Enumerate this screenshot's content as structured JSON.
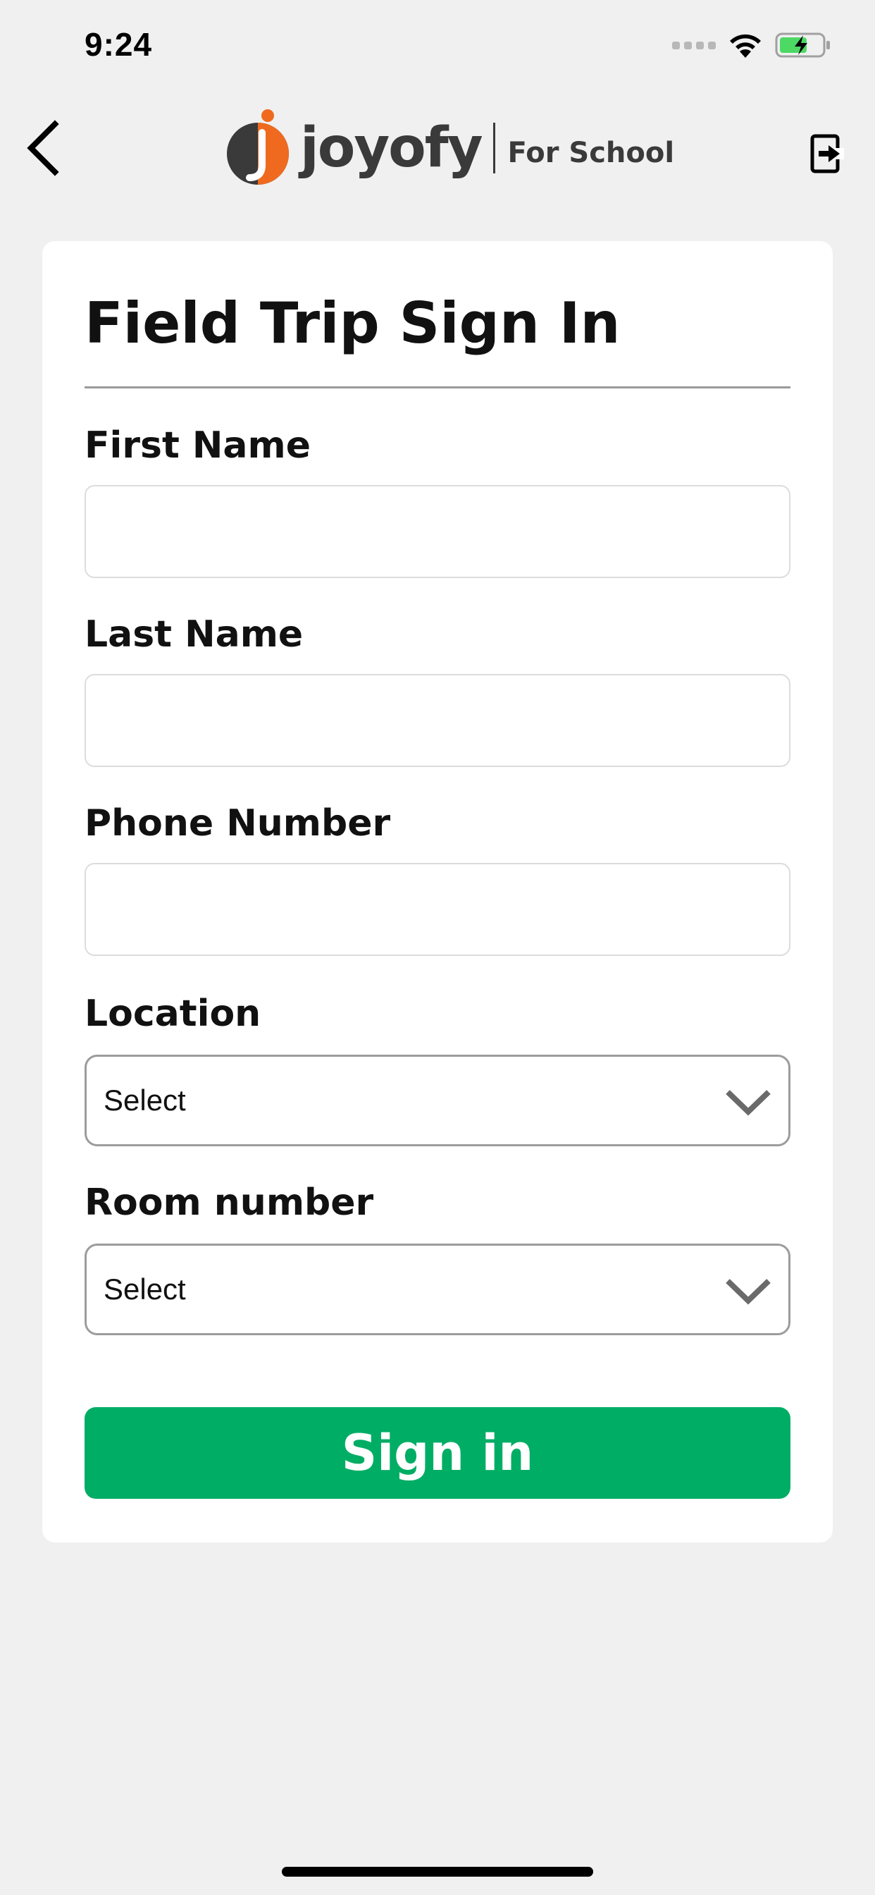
{
  "status_bar": {
    "time": "9:24",
    "icons": [
      "signal-icon",
      "wifi-icon",
      "battery-charging-icon"
    ]
  },
  "header": {
    "back_icon": "chevron-left-icon",
    "logo": {
      "word": "joyofy",
      "sub": "For School",
      "colors": {
        "dark": "#3a3a3a",
        "accent": "#ef6a1f"
      }
    },
    "logout_icon": "logout-icon"
  },
  "form": {
    "title": "Field Trip Sign In",
    "fields": {
      "first_name": {
        "label": "First Name",
        "value": "",
        "placeholder": ""
      },
      "last_name": {
        "label": "Last Name",
        "value": "",
        "placeholder": ""
      },
      "phone_number": {
        "label": "Phone Number",
        "value": "",
        "placeholder": ""
      },
      "location": {
        "label": "Location",
        "selected": "Select"
      },
      "room_number": {
        "label": "Room number",
        "selected": "Select"
      }
    },
    "submit_label": "Sign in"
  },
  "colors": {
    "background": "#f0f0f0",
    "card": "#ffffff",
    "primary_button": "#00ad65"
  }
}
